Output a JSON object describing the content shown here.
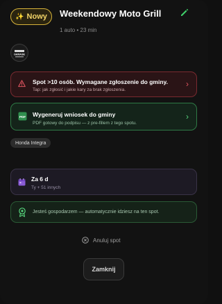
{
  "header": {
    "badge_icon": "sparkles-icon",
    "badge_label": "Nowy",
    "title": "Weekendowy Moto Grill",
    "meta": "1 auto • 23 min",
    "edit_icon": "pencil-icon"
  },
  "participants": {
    "avatar_text": "GARAGE"
  },
  "warning_card": {
    "title": "Spot >10 osób. Wymagane zgłoszenie do gminy.",
    "subtitle": "Tap: jak zgłosić i jakie kary za brak zgłoszenia.",
    "icon": "warning-triangle-icon",
    "accent": "#e05560"
  },
  "generate_card": {
    "title": "Wygeneruj wniosek do gminy",
    "subtitle": "PDF gotowy do podpisu — z pre-fillem z tego spotu.",
    "icon": "pdf-icon",
    "accent": "#57d37c"
  },
  "car_chip": "Honda Integra",
  "date_card": {
    "title": "Za 6 d",
    "subtitle": "Ty + 51 innych",
    "icon": "calendar-icon",
    "accent": "#8a5cd6"
  },
  "host_card": {
    "text": "Jesteś gospodarzem — automatycznie idziesz na ten spot.",
    "icon": "award-icon"
  },
  "cancel_label": "Anuluj spot",
  "close_label": "Zamknij"
}
